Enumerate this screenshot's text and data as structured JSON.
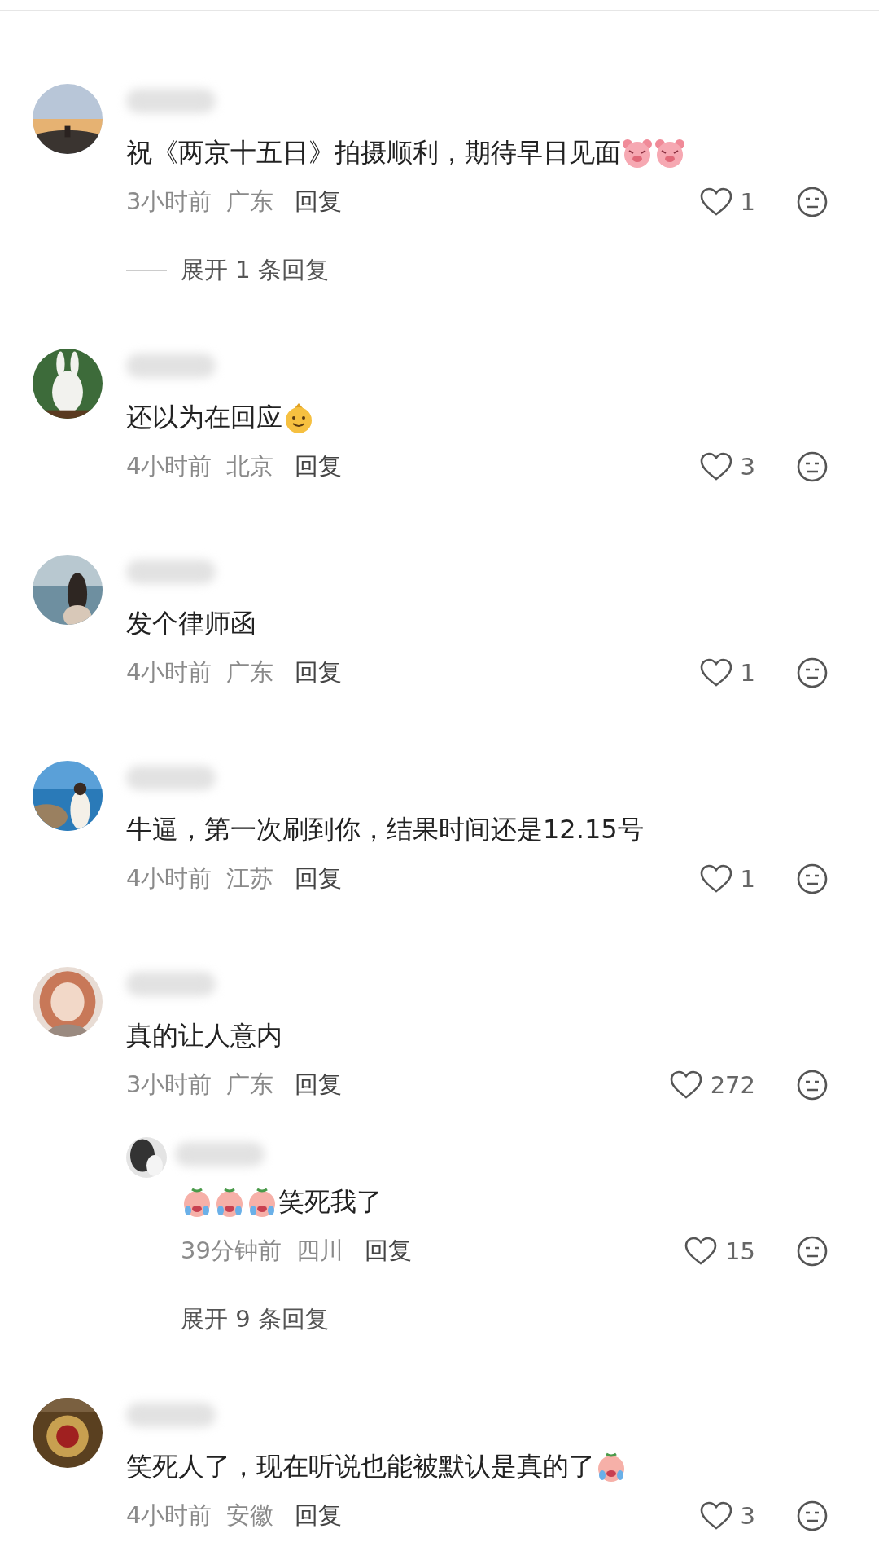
{
  "comments": [
    {
      "avatar": {
        "kind": "picture"
      },
      "parts": [
        {
          "kind": "text",
          "text": "祝《两京十五日》拍摄顺利，期待早日见面"
        },
        {
          "kind": "pig"
        },
        {
          "kind": "pig"
        }
      ],
      "time": "3小时前",
      "location": "广东",
      "reply_label": "回复",
      "likes": "1",
      "expand": "展开 1 条回复"
    },
    {
      "avatar": {
        "kind": "picture"
      },
      "parts": [
        {
          "kind": "text",
          "text": "还以为在回应"
        },
        {
          "kind": "gold"
        }
      ],
      "time": "4小时前",
      "location": "北京",
      "reply_label": "回复",
      "likes": "3"
    },
    {
      "avatar": {
        "kind": "picture"
      },
      "parts": [
        {
          "kind": "text",
          "text": "发个律师函"
        }
      ],
      "time": "4小时前",
      "location": "广东",
      "reply_label": "回复",
      "likes": "1"
    },
    {
      "avatar": {
        "kind": "picture"
      },
      "parts": [
        {
          "kind": "text",
          "text": "牛逼，第一次刷到你，结果时间还是12.15号"
        }
      ],
      "time": "4小时前",
      "location": "江苏",
      "reply_label": "回复",
      "likes": "1"
    },
    {
      "avatar": {
        "kind": "picture"
      },
      "parts": [
        {
          "kind": "text",
          "text": "真的让人意内"
        }
      ],
      "time": "3小时前",
      "location": "广东",
      "reply_label": "回复",
      "likes": "272",
      "replies": [
        {
          "avatar": {
            "kind": "picture"
          },
          "parts": [
            {
              "kind": "crying"
            },
            {
              "kind": "crying"
            },
            {
              "kind": "crying"
            },
            {
              "kind": "text",
              "text": "笑死我了"
            }
          ],
          "time": "39分钟前",
          "location": "四川",
          "reply_label": "回复",
          "likes": "15"
        }
      ],
      "expand": "展开 9 条回复"
    },
    {
      "avatar": {
        "kind": "picture"
      },
      "parts": [
        {
          "kind": "text",
          "text": "笑死人了，现在听说也能被默认是真的了"
        },
        {
          "kind": "crying"
        }
      ],
      "time": "4小时前",
      "location": "安徽",
      "reply_label": "回复",
      "likes": "3"
    }
  ]
}
